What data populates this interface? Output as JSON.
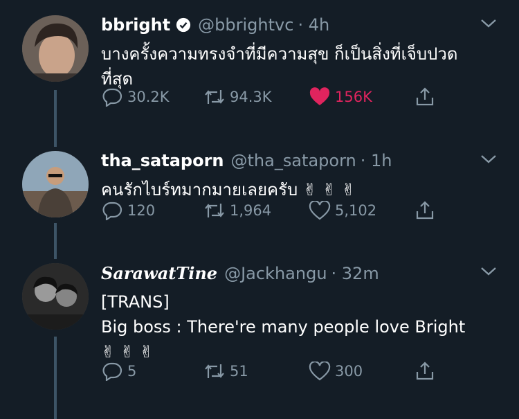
{
  "tweets": [
    {
      "name": "bbright",
      "verified": true,
      "handle": "@bbrightvc",
      "time": "· 4h",
      "lines": [
        "บางครั้งความทรงจำที่มีความสุข ก็เป็นสิ่งที่เจ็บปวด",
        "ที่สุด"
      ],
      "replies": "30.2K",
      "retweets": "94.3K",
      "likes": "156K",
      "liked": true
    },
    {
      "name": "tha_sataporn",
      "verified": false,
      "handle": "@tha_sataporn",
      "time": "· 1h",
      "lines": [
        "คนรักไบร์ทมากมายเลยครับ ✌ ✌ ✌"
      ],
      "replies": "120",
      "retweets": "1,964",
      "likes": "5,102",
      "liked": false
    },
    {
      "name": "SarawatTine",
      "verified": false,
      "handle": "@Jackhangu",
      "time": "· 32m",
      "lines": [
        "[TRANS]",
        "Big boss : There're many people love Bright",
        "✌ ✌ ✌"
      ],
      "replies": "5",
      "retweets": "51",
      "likes": "300",
      "liked": false
    }
  ],
  "colors": {
    "background": "#141d26",
    "secondary_text": "#8899a6",
    "like_red": "#e0245e",
    "thread_line": "#3d5466"
  },
  "icons": [
    "verified-badge-icon",
    "chevron-down-icon",
    "reply-icon",
    "retweet-icon",
    "like-icon",
    "share-icon"
  ]
}
